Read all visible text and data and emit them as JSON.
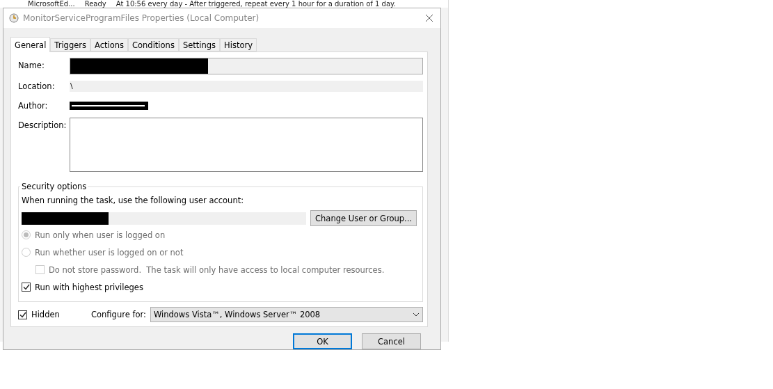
{
  "background_window": {
    "row": {
      "name": "MicrosoftEd...",
      "status": "Ready",
      "trigger": "At 10:56 every day - After triggered, repeat every 1 hour for a duration of 1 day."
    }
  },
  "window": {
    "title": "MonitorServiceProgramFiles Properties (Local Computer)"
  },
  "tabs": [
    {
      "label": "General",
      "selected": true
    },
    {
      "label": "Triggers",
      "selected": false
    },
    {
      "label": "Actions",
      "selected": false
    },
    {
      "label": "Conditions",
      "selected": false
    },
    {
      "label": "Settings",
      "selected": false
    },
    {
      "label": "History",
      "selected": false
    }
  ],
  "general": {
    "fields": [
      {
        "label": "Name:",
        "kind": "redacted"
      },
      {
        "label": "Location:",
        "kind": "readonly",
        "value": "\\"
      },
      {
        "label": "Author:",
        "kind": "redacted-text"
      },
      {
        "label": "Description:",
        "kind": "textarea"
      }
    ]
  },
  "security": {
    "title": "Security options",
    "account_label": "When running the task, use the following user account:",
    "change_button": "Change User or Group...",
    "options": [
      {
        "kind": "radio",
        "label": "Run only when user is logged on",
        "selected": true,
        "disabled": true
      },
      {
        "kind": "radio",
        "label": "Run whether user is logged on or not",
        "selected": false,
        "disabled": true,
        "children": [
          {
            "kind": "checkbox",
            "label": "Do not store password.  The task will only have access to local computer resources.",
            "checked": false,
            "disabled": true
          }
        ]
      },
      {
        "kind": "checkbox",
        "label": "Run with highest privileges",
        "checked": true,
        "disabled": false
      }
    ]
  },
  "hidden": {
    "label": "Hidden",
    "checked": true
  },
  "configure": {
    "label": "Configure for:",
    "value": "Windows Vista™, Windows Server™ 2008"
  },
  "buttons": [
    {
      "label": "OK",
      "default": true
    },
    {
      "label": "Cancel",
      "default": false
    }
  ]
}
